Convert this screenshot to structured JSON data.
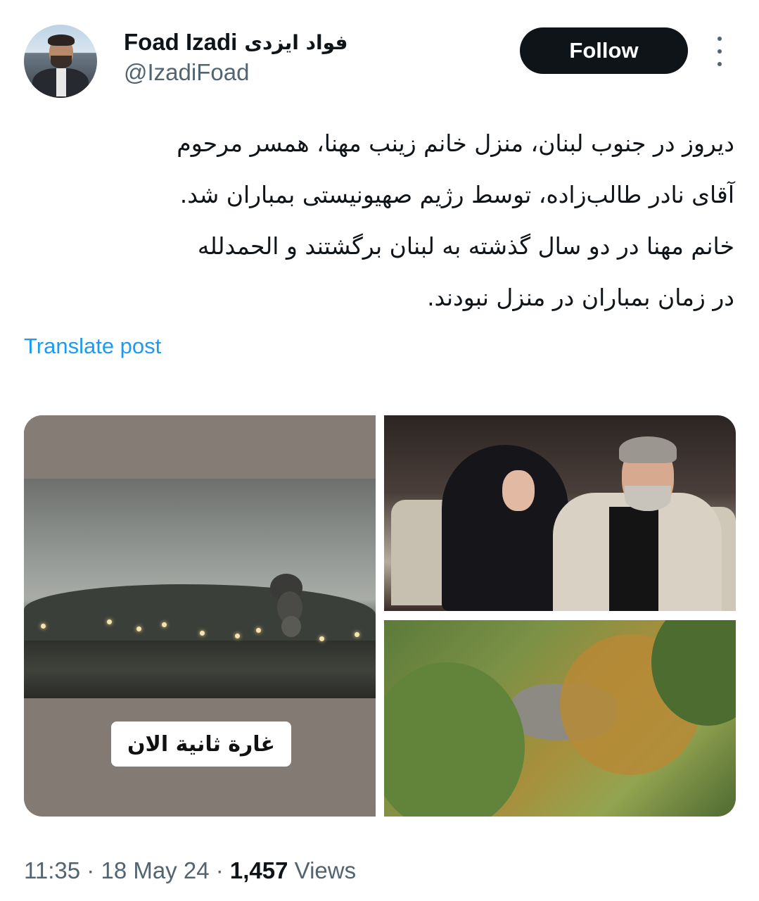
{
  "author": {
    "name": "Foad Izadi",
    "name_fa": "فواد ایزدی",
    "handle": "@IzadiFoad"
  },
  "follow_label": "Follow",
  "tweet_lines": [
    "دیروز در جنوب لبنان، منزل خانم زینب مهنا، همسر مرحوم",
    "آقای نادر طالب‌زاده، توسط رژیم صهیونیستی بمباران شد.",
    "خانم مهنا در دو سال گذشته به لبنان برگشتند و الحمدلله",
    "در زمان بمباران در منزل نبودند."
  ],
  "translate_label": "Translate post",
  "media": {
    "left_caption": "غارة ثانية الان"
  },
  "footer": {
    "time": "11:35",
    "sep1": " · ",
    "date": "18 May 24",
    "sep2": " · ",
    "views_count": "1,457",
    "views_label": " Views"
  },
  "colors": {
    "text": "#0f1419",
    "secondary": "#536471",
    "link": "#1d9bf0",
    "button_bg": "#0f1419"
  }
}
